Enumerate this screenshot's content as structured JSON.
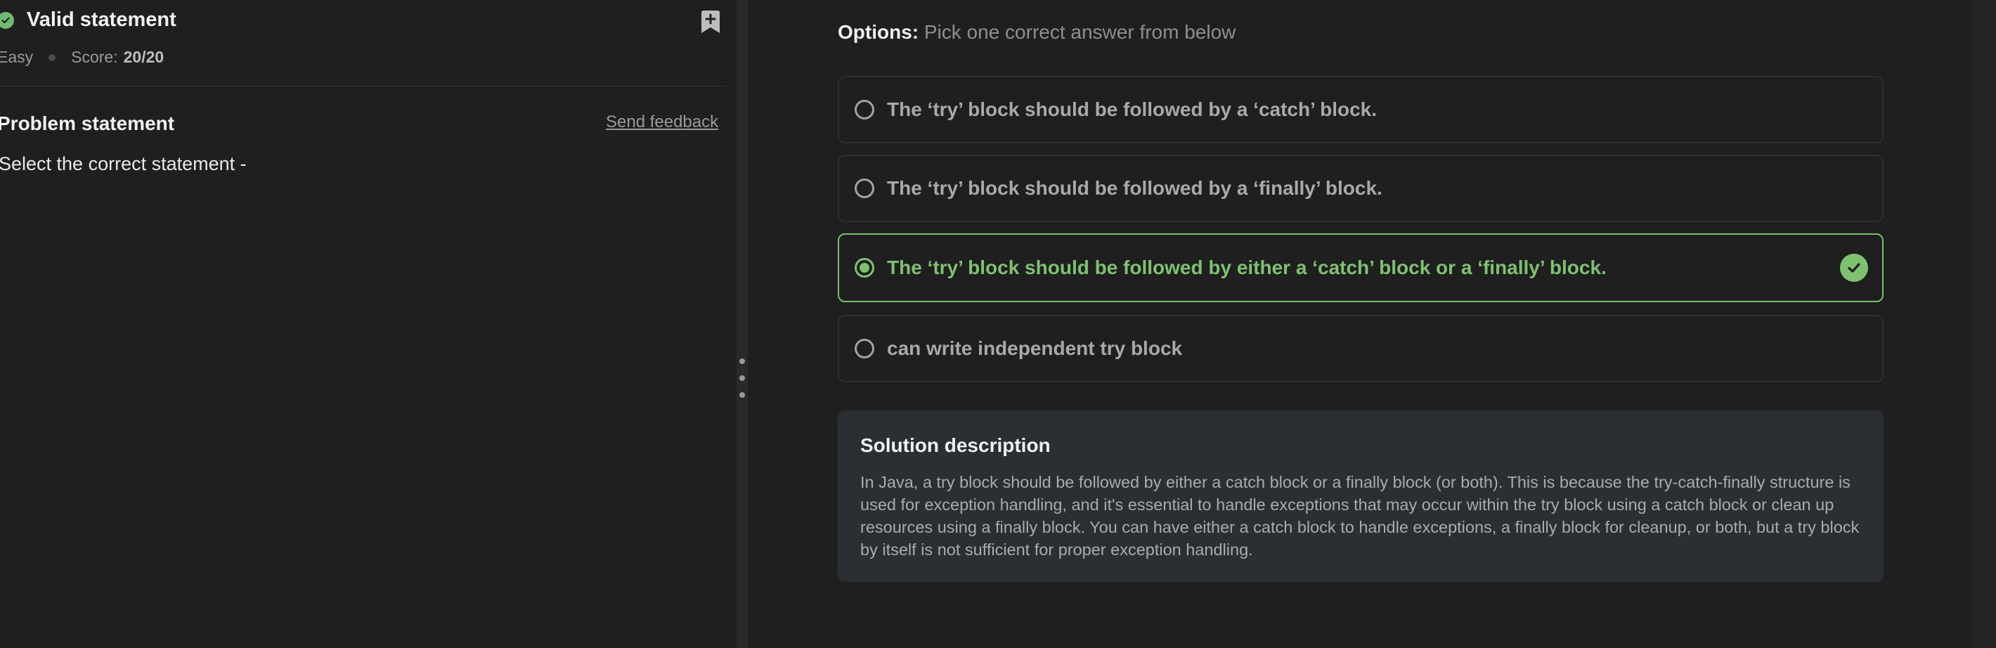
{
  "problem": {
    "title": "Valid statement",
    "difficulty": "Easy",
    "score_label": "Score:",
    "score_value": "20/20",
    "statement_heading": "Problem statement",
    "send_feedback": "Send feedback",
    "statement_text": "Select the correct statement -"
  },
  "options": {
    "label_bold": "Options:",
    "label_rest": " Pick one correct answer from below",
    "items": [
      {
        "label": "The ‘try’ block should be followed by a ‘catch’ block.",
        "selected": false
      },
      {
        "label": "The ‘try’ block should be followed by a ‘finally’ block.",
        "selected": false
      },
      {
        "label": "The ‘try’ block should be followed by either a ‘catch’ block or a ‘finally’ block.",
        "selected": true
      },
      {
        "label": "can write independent try block",
        "selected": false
      }
    ]
  },
  "solution": {
    "title": "Solution description",
    "text": "In Java, a try block should be followed by either a catch block or a finally block (or both). This is because the try-catch-finally structure is used for exception handling, and it's essential to handle exceptions that may occur within the try block using a catch block or clean up resources using a finally block. You can have either a catch block to handle exceptions, a finally block for cleanup, or both, but a try block by itself is not sufficient for proper exception handling."
  },
  "colors": {
    "success": "#7ec26f",
    "background": "#1f1f1f",
    "solution_bg": "#2b2f33"
  },
  "icons": [
    "check-circle-icon",
    "bookmark-add-icon",
    "radio-icon",
    "check-badge-icon",
    "splitter-dots-icon"
  ]
}
